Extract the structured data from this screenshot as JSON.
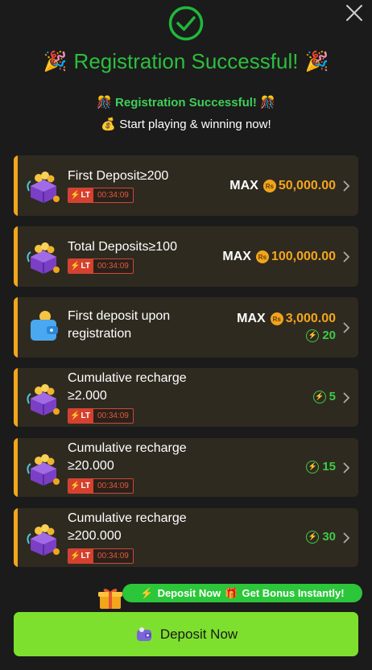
{
  "header": {
    "close_icon": "close-icon",
    "check_icon": "check-circle-icon",
    "title": "Registration Successful!",
    "emoji_left": "🎉",
    "emoji_right": "🎉",
    "subtitle1": "🎊 Registration Successful! 🎊",
    "subtitle2": "💰 Start playing & winning now!"
  },
  "cards": [
    {
      "label_line1": "First Deposit≥200",
      "label_line2": "",
      "lt": "LT",
      "timer": "00:34:09",
      "max": "MAX",
      "currency": "Rs",
      "amount": "50,000.00",
      "points": "",
      "icon": "treasure-chest-icon"
    },
    {
      "label_line1": "Total Deposits≥100",
      "label_line2": "",
      "lt": "LT",
      "timer": "00:34:09",
      "max": "MAX",
      "currency": "Rs",
      "amount": "100,000.00",
      "points": "",
      "icon": "treasure-chest-icon"
    },
    {
      "label_line1": "First deposit upon",
      "label_line2": "registration",
      "lt": "",
      "timer": "",
      "max": "MAX",
      "currency": "Rs",
      "amount": "3,000.00",
      "points": "20",
      "icon": "wallet-icon"
    },
    {
      "label_line1": "Cumulative recharge",
      "label_line2": "≥2.000",
      "lt": "LT",
      "timer": "00:34:09",
      "max": "",
      "currency": "",
      "amount": "",
      "points": "5",
      "icon": "treasure-chest-icon"
    },
    {
      "label_line1": "Cumulative recharge",
      "label_line2": "≥20.000",
      "lt": "LT",
      "timer": "00:34:09",
      "max": "",
      "currency": "",
      "amount": "",
      "points": "15",
      "icon": "treasure-chest-icon"
    },
    {
      "label_line1": "Cumulative recharge",
      "label_line2": "≥200.000",
      "lt": "LT",
      "timer": "00:34:09",
      "max": "",
      "currency": "",
      "amount": "",
      "points": "30",
      "icon": "treasure-chest-icon"
    }
  ],
  "bonus": {
    "text1": "Deposit Now",
    "text2": "Get Bonus Instantly!",
    "icon": "gift-icon"
  },
  "deposit_button": {
    "label": "Deposit Now",
    "icon": "wallet-icon"
  },
  "colors": {
    "accent_green": "#2dbe3f",
    "button_green": "#7ee02e",
    "orange": "#f3a61c",
    "card_bg": "#2f2a20",
    "timer_red": "#d7402d"
  }
}
